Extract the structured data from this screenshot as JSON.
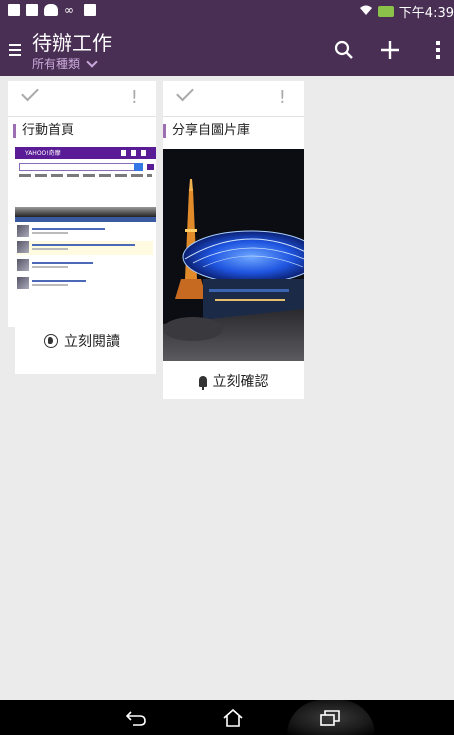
{
  "status_bar": {
    "left_icons": [
      "doc-icon",
      "mail-icon",
      "cloud-icon",
      "infinity-icon",
      "download-icon"
    ],
    "time": "下午4:39",
    "battery_color": "#8bc34a"
  },
  "action_bar": {
    "title": "待辦工作",
    "subtitle": "所有種類",
    "background": "#4a2f55"
  },
  "cards": [
    {
      "title": "行動首頁",
      "action_label": "立刻閱讀",
      "action_icon": "globe-icon"
    },
    {
      "title": "分享自圖片庫",
      "action_label": "立刻確認",
      "action_icon": "pin-icon"
    }
  ],
  "web_thumbnail": {
    "logo": "YAHOO!奇摩"
  },
  "nav_bar": {
    "buttons": [
      "back-icon",
      "home-icon",
      "recent-apps-icon"
    ]
  }
}
